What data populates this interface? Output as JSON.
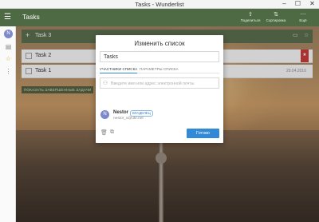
{
  "window": {
    "title": "Tasks - Wunderlist",
    "minimize": "–",
    "maximize": "☐",
    "close": "✕"
  },
  "topbar": {
    "list_title": "Tasks",
    "actions": [
      {
        "icon": "share-icon",
        "glyph": "⇪",
        "label": "Поделиться"
      },
      {
        "icon": "sort-icon",
        "glyph": "⇅",
        "label": "Сортировка"
      },
      {
        "icon": "more-icon",
        "glyph": "⋯",
        "label": "Ещё"
      }
    ]
  },
  "sidebar": {
    "avatar_initial": "N"
  },
  "add_task": {
    "text": "Task 3"
  },
  "tasks": [
    {
      "title": "Task 2",
      "flag": "★"
    },
    {
      "title": "Task 1",
      "date": "29.04.2016"
    }
  ],
  "show_completed": "ПОКАЗАТЬ ЗАВЕРШЕННЫЕ ЗАДАЧИ",
  "dialog": {
    "title": "Изменить список",
    "name_value": "Tasks",
    "tabs": [
      "УЧАСТНИКИ СПИСКА",
      "ПАРАМЕТРЫ СПИСКА"
    ],
    "invite_placeholder": "Введите имя или адрес электронной почты",
    "member": {
      "initial": "N",
      "name": "Nestor",
      "badge": "ВЛАДЕЛЕЦ",
      "email": "nestor_s@ukr.net"
    },
    "done_label": "Готово"
  },
  "colors": {
    "accent": "#328ad6",
    "topbar": "#4e6a44",
    "flag": "#d23c3c"
  }
}
